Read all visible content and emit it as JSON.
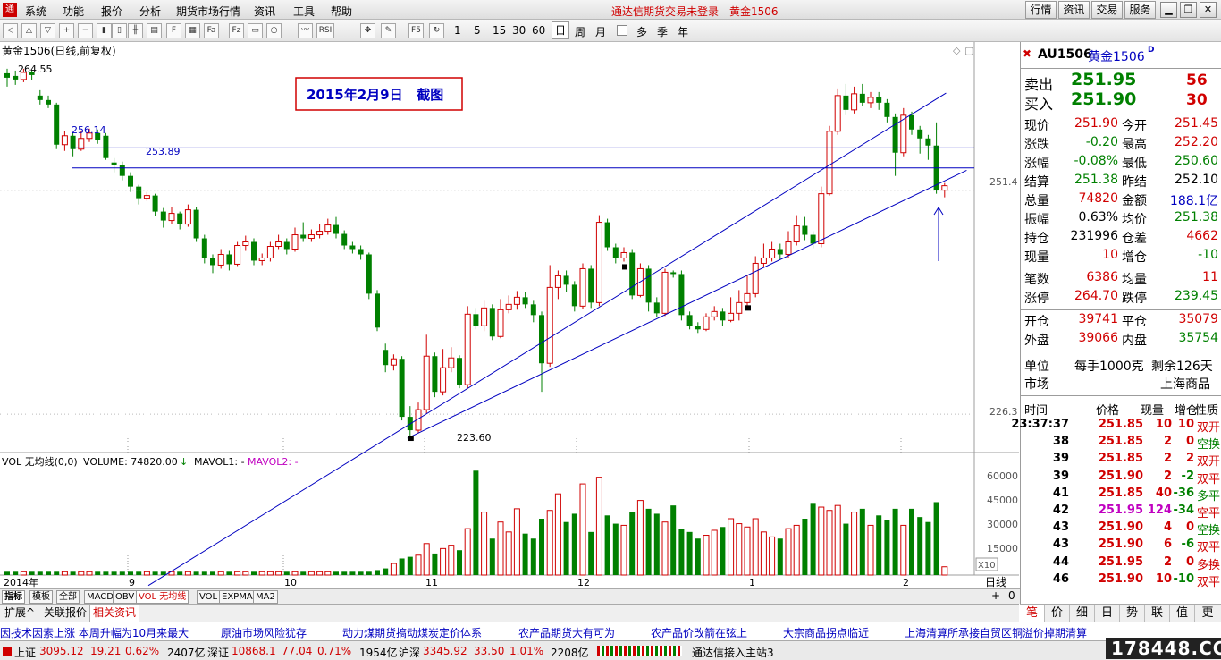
{
  "menubar": {
    "items": [
      "系统",
      "功能",
      "报价",
      "分析",
      "期货市场行情",
      "资讯",
      "工具",
      "帮助"
    ],
    "title": "通达信期货交易未登录",
    "contract_title": "黄金1506",
    "right_buttons": [
      "行情",
      "资讯",
      "交易",
      "服务"
    ]
  },
  "toolbar": {
    "periods": [
      "1",
      "5",
      "15",
      "30",
      "60",
      "日",
      "周",
      "月",
      "多",
      "季",
      "年"
    ]
  },
  "chart": {
    "title": "黄金1506(日线,前复权)",
    "annotation": "2015年2月9日   截图",
    "price_labels": {
      "high": "264.55",
      "low": "223.60",
      "line1": "256.14",
      "line2": "253.89"
    },
    "axis_ticks": [
      "251.4",
      "226.3"
    ],
    "vol_ticks": [
      "60000",
      "45000",
      "30000",
      "15000"
    ],
    "vol_scale": "X10",
    "x_labels": [
      "2014年",
      "9",
      "10",
      "11",
      "12",
      "1",
      "2"
    ],
    "vol_title": "VOL 无均线(0,0)",
    "vol_value": "VOLUME: 74820.00",
    "vol_arrow": "↓",
    "mavol1": "MAVOL1: -",
    "mavol2": "MAVOL2: -",
    "right_unit": "日线",
    "right_ctrl": [
      "+",
      "0"
    ]
  },
  "chart_data": {
    "type": "candlestick",
    "title": "黄金1506(日线,前复权)",
    "ylim": [
      222,
      268
    ],
    "candles": [
      [
        264.5,
        264.0,
        265.0,
        263.0
      ],
      [
        264.2,
        263.8,
        264.8,
        263.2
      ],
      [
        263.8,
        264.6,
        265.0,
        263.5
      ],
      [
        264.6,
        264.3,
        264.8,
        263.7
      ],
      [
        262.0,
        261.5,
        262.6,
        261.0
      ],
      [
        261.5,
        261.0,
        262.0,
        260.6
      ],
      [
        261.0,
        256.5,
        261.2,
        256.0
      ],
      [
        256.5,
        257.5,
        258.0,
        255.8
      ],
      [
        257.5,
        256.0,
        257.8,
        255.2
      ],
      [
        256.0,
        257.2,
        258.0,
        255.8
      ],
      [
        257.2,
        257.8,
        258.3,
        256.8
      ],
      [
        257.8,
        257.0,
        258.2,
        256.6
      ],
      [
        257.5,
        255.0,
        257.8,
        254.8
      ],
      [
        254.5,
        254.2,
        255.0,
        253.4
      ],
      [
        254.2,
        253.0,
        254.6,
        252.5
      ],
      [
        253.0,
        251.8,
        253.4,
        251.2
      ],
      [
        251.8,
        250.5,
        252.0,
        249.8
      ],
      [
        250.5,
        250.8,
        251.2,
        250.2
      ],
      [
        250.8,
        249.0,
        251.0,
        248.5
      ],
      [
        249.0,
        248.0,
        249.4,
        247.2
      ],
      [
        248.0,
        248.8,
        249.5,
        247.6
      ],
      [
        248.8,
        247.6,
        249.0,
        247.0
      ],
      [
        247.6,
        249.2,
        249.8,
        247.3
      ],
      [
        249.2,
        246.0,
        249.5,
        245.6
      ],
      [
        246.0,
        243.8,
        246.4,
        243.2
      ],
      [
        243.8,
        243.0,
        244.2,
        242.1
      ],
      [
        243.0,
        244.2,
        244.8,
        242.6
      ],
      [
        244.2,
        243.1,
        244.6,
        242.4
      ],
      [
        243.1,
        245.2,
        245.6,
        242.9
      ],
      [
        245.2,
        245.6,
        246.3,
        244.6
      ],
      [
        245.6,
        243.5,
        246.0,
        243.0
      ],
      [
        243.5,
        243.8,
        244.3,
        243.0
      ],
      [
        243.8,
        245.1,
        245.6,
        243.4
      ],
      [
        245.1,
        245.6,
        246.4,
        244.8
      ],
      [
        245.6,
        244.8,
        246.0,
        244.2
      ],
      [
        244.8,
        246.4,
        247.2,
        244.5
      ],
      [
        246.4,
        246.0,
        247.8,
        245.6
      ],
      [
        246.0,
        246.4,
        247.0,
        245.6
      ],
      [
        246.4,
        246.8,
        247.6,
        246.0
      ],
      [
        246.8,
        247.5,
        248.2,
        246.4
      ],
      [
        247.5,
        246.5,
        248.4,
        246.0
      ],
      [
        246.5,
        245.2,
        246.9,
        244.8
      ],
      [
        245.2,
        244.8,
        245.6,
        244.3
      ],
      [
        244.8,
        244.2,
        245.2,
        243.6
      ],
      [
        244.2,
        239.8,
        244.4,
        239.2
      ],
      [
        239.8,
        236.0,
        240.2,
        235.6
      ],
      [
        233.5,
        231.8,
        234.2,
        231.0
      ],
      [
        231.8,
        232.5,
        233.0,
        231.2
      ],
      [
        232.5,
        226.0,
        232.8,
        225.6
      ],
      [
        226.0,
        224.5,
        227.2,
        223.6
      ],
      [
        224.5,
        226.8,
        227.6,
        224.2
      ],
      [
        226.8,
        232.8,
        235.2,
        226.4
      ],
      [
        232.8,
        228.8,
        233.2,
        228.2
      ],
      [
        228.8,
        231.5,
        233.6,
        228.4
      ],
      [
        231.5,
        232.6,
        233.8,
        231.0
      ],
      [
        232.6,
        229.6,
        232.9,
        229.2
      ],
      [
        229.6,
        237.5,
        238.4,
        229.2
      ],
      [
        237.5,
        236.2,
        238.2,
        235.8
      ],
      [
        236.2,
        238.2,
        239.0,
        235.6
      ],
      [
        238.2,
        235.0,
        238.6,
        234.6
      ],
      [
        235.0,
        238.0,
        239.2,
        234.8
      ],
      [
        238.0,
        238.6,
        239.6,
        237.6
      ],
      [
        238.6,
        239.4,
        240.1,
        238.0
      ],
      [
        239.4,
        238.6,
        240.0,
        238.2
      ],
      [
        238.6,
        237.4,
        239.0,
        236.6
      ],
      [
        237.4,
        232.0,
        237.8,
        228.8
      ],
      [
        232.0,
        240.5,
        243.0,
        231.6
      ],
      [
        240.5,
        241.8,
        242.4,
        239.2
      ],
      [
        241.8,
        240.8,
        242.4,
        240.0
      ],
      [
        240.8,
        238.4,
        241.2,
        237.8
      ],
      [
        238.4,
        242.6,
        243.2,
        238.1
      ],
      [
        242.6,
        238.8,
        243.0,
        238.2
      ],
      [
        238.8,
        247.8,
        248.6,
        238.4
      ],
      [
        247.8,
        245.0,
        248.2,
        244.6
      ],
      [
        245.0,
        243.8,
        245.4,
        243.2
      ],
      [
        243.8,
        244.4,
        245.0,
        243.4
      ],
      [
        244.4,
        239.6,
        244.8,
        239.2
      ],
      [
        239.6,
        242.6,
        243.2,
        239.4
      ],
      [
        242.6,
        238.8,
        243.0,
        237.8
      ],
      [
        238.8,
        237.6,
        239.4,
        237.2
      ],
      [
        237.6,
        242.2,
        242.6,
        237.3
      ],
      [
        242.2,
        242.0,
        242.4,
        241.6
      ],
      [
        242.0,
        237.4,
        242.4,
        236.8
      ],
      [
        237.4,
        236.2,
        237.8,
        235.8
      ],
      [
        236.2,
        235.8,
        236.6,
        235.4
      ],
      [
        235.8,
        237.2,
        237.6,
        235.6
      ],
      [
        237.2,
        237.8,
        238.4,
        236.8
      ],
      [
        237.8,
        236.8,
        238.2,
        236.2
      ],
      [
        236.8,
        237.6,
        239.4,
        236.6
      ],
      [
        237.6,
        238.8,
        240.2,
        236.8
      ],
      [
        238.8,
        239.8,
        241.8,
        238.4
      ],
      [
        239.8,
        243.2,
        244.0,
        239.4
      ],
      [
        243.2,
        243.8,
        245.4,
        242.8
      ],
      [
        243.8,
        244.8,
        245.6,
        243.4
      ],
      [
        244.8,
        244.2,
        245.4,
        243.6
      ],
      [
        244.2,
        245.6,
        246.8,
        243.8
      ],
      [
        245.6,
        247.4,
        248.6,
        245.2
      ],
      [
        247.4,
        246.4,
        248.4,
        245.8
      ],
      [
        246.4,
        245.4,
        246.8,
        244.9
      ],
      [
        245.4,
        251.0,
        251.8,
        245.0
      ],
      [
        251.0,
        258.0,
        258.6,
        250.8
      ],
      [
        258.0,
        262.0,
        262.8,
        257.6
      ],
      [
        262.0,
        260.4,
        263.3,
        259.8
      ],
      [
        260.4,
        262.2,
        263.0,
        260.0
      ],
      [
        262.2,
        261.2,
        263.3,
        260.8
      ],
      [
        261.2,
        261.8,
        262.4,
        260.6
      ],
      [
        261.8,
        261.2,
        262.4,
        260.4
      ],
      [
        261.2,
        259.6,
        261.6,
        259.0
      ],
      [
        259.6,
        255.6,
        260.0,
        253.0
      ],
      [
        255.6,
        259.8,
        260.6,
        255.2
      ],
      [
        259.8,
        258.2,
        260.2,
        257.6
      ],
      [
        258.2,
        257.2,
        258.6,
        255.5
      ],
      [
        257.2,
        256.4,
        257.6,
        254.8
      ],
      [
        256.4,
        251.4,
        259.0,
        251.0
      ],
      [
        251.4,
        251.9,
        252.2,
        250.6
      ]
    ],
    "volumes": [
      2,
      2,
      2,
      2,
      2,
      2,
      2,
      2,
      2,
      2,
      2,
      2,
      2,
      2,
      2,
      2,
      2,
      2,
      2,
      2,
      2,
      2,
      2,
      2,
      2,
      2,
      2,
      2,
      2,
      2,
      2,
      2,
      2,
      2,
      2,
      2,
      2,
      2,
      2,
      2,
      2,
      2,
      2,
      2,
      2,
      3,
      4,
      7,
      10,
      11,
      12,
      19,
      13,
      16,
      18,
      15,
      28,
      63,
      38,
      22,
      32,
      26,
      40,
      25,
      22,
      34,
      39,
      49,
      32,
      37,
      55,
      26,
      59,
      36,
      31,
      30,
      38,
      45,
      40,
      37,
      32,
      42,
      28,
      26,
      22,
      24,
      27,
      29,
      34,
      31,
      29,
      34,
      26,
      23,
      22,
      28,
      30,
      34,
      43,
      41,
      39,
      42,
      31,
      38,
      40,
      30,
      36,
      33,
      40,
      30,
      40,
      35,
      32,
      44,
      5
    ],
    "volume_unit": "X10",
    "vol_ylim": [
      0,
      68
    ],
    "horizontal_lines": [
      256.14,
      253.89
    ],
    "current_price_level": 251.4,
    "channel_upper": [
      [
        56,
        229
      ],
      [
        114,
        262
      ]
    ],
    "channel_lower": [
      [
        49,
        223.6
      ],
      [
        114,
        252.3
      ]
    ]
  },
  "quote": {
    "code": "AU1506",
    "name": "黄金1506",
    "sell_label": "卖出",
    "sell_price": "251.95",
    "sell_vol": "56",
    "buy_label": "买入",
    "buy_price": "251.90",
    "buy_vol": "30",
    "rows": [
      [
        "现价",
        "251.90",
        "今开",
        "251.45",
        "red",
        "red"
      ],
      [
        "涨跌",
        "-0.20",
        "最高",
        "252.20",
        "grn",
        "red"
      ],
      [
        "涨幅",
        "-0.08%",
        "最低",
        "250.60",
        "grn",
        "grn"
      ],
      [
        "结算",
        "251.38",
        "昨结",
        "252.10",
        "grn",
        "blk"
      ],
      [
        "总量",
        "74820",
        "金额",
        "188.1亿",
        "red",
        "blu"
      ],
      [
        "振幅",
        "0.63%",
        "均价",
        "251.38",
        "blk",
        "grn"
      ],
      [
        "持仓",
        "231996",
        "仓差",
        "4662",
        "blk",
        "red"
      ],
      [
        "现量",
        "10",
        "增仓",
        "-10",
        "red",
        "grn"
      ]
    ],
    "rows2": [
      [
        "笔数",
        "6386",
        "均量",
        "11",
        "red",
        "red"
      ],
      [
        "涨停",
        "264.70",
        "跌停",
        "239.45",
        "red",
        "grn"
      ]
    ],
    "rows3": [
      [
        "开仓",
        "39741",
        "平仓",
        "35079",
        "red",
        "red"
      ],
      [
        "外盘",
        "39066",
        "内盘",
        "35754",
        "red",
        "grn"
      ]
    ],
    "unit_label": "单位",
    "unit_value": "每手1000克",
    "remain": "剩余126天",
    "market_label": "市场",
    "market_value": "上海商品",
    "tick_headers": [
      "时间",
      "价格",
      "现量",
      "增仓",
      "性质"
    ],
    "ticks": [
      [
        "23:37:37",
        "251.85",
        "10",
        "10",
        "双开",
        "red",
        "red",
        "red"
      ],
      [
        "38",
        "251.85",
        "2",
        "0",
        "空换",
        "red",
        "red",
        "grn"
      ],
      [
        "39",
        "251.85",
        "2",
        "2",
        "双开",
        "red",
        "red",
        "red"
      ],
      [
        "39",
        "251.90",
        "2",
        "-2",
        "双平",
        "red",
        "grn",
        "red"
      ],
      [
        "41",
        "251.85",
        "40",
        "-36",
        "多平",
        "red",
        "grn",
        "grn"
      ],
      [
        "42",
        "251.95",
        "124",
        "-34",
        "空平",
        "mag",
        "grn",
        "red"
      ],
      [
        "43",
        "251.90",
        "4",
        "0",
        "空换",
        "red",
        "red",
        "grn"
      ],
      [
        "43",
        "251.90",
        "6",
        "-6",
        "双平",
        "red",
        "grn",
        "red"
      ],
      [
        "44",
        "251.95",
        "2",
        "0",
        "多换",
        "red",
        "red",
        "red"
      ],
      [
        "46",
        "251.90",
        "10",
        "-10",
        "双平",
        "red",
        "grn",
        "red"
      ]
    ]
  },
  "tabs": [
    "指标",
    "模板",
    "全部",
    "MACD",
    "OBV",
    "VOL 无均线",
    "VOL",
    "EXPMA",
    "MA2"
  ],
  "tabs2": [
    "扩展^",
    "关联报价",
    "相关资讯"
  ],
  "rtabs": [
    "笔",
    "价",
    "细",
    "日",
    "势",
    "联",
    "值",
    "更"
  ],
  "news": [
    "因技术因素上涨 本周升幅为10月来最大",
    "原油市场风险犹存",
    "动力煤期货搞动煤炭定价体系",
    "农产品期货大有可为",
    "农产品价改箭在弦上",
    "大宗商品拐点临近",
    "上海清算所承接自贸区铜溢价掉期清算"
  ],
  "status": {
    "sh_label": "上证",
    "sh_val": "3095.12",
    "sh_chg": "19.21",
    "sh_pct": "0.62%",
    "sh_amt": "2407亿",
    "sz_label": "深证",
    "sz_val": "10868.1",
    "sz_chg": "77.04",
    "sz_pct": "0.71%",
    "sz_amt": "1954亿",
    "hs_label": "沪深",
    "hs_val": "3345.92",
    "hs_chg": "33.50",
    "hs_pct": "1.01%",
    "hs_amt": "2208亿",
    "conn": "通达信接入主站3",
    "logo": "178448.COM"
  }
}
